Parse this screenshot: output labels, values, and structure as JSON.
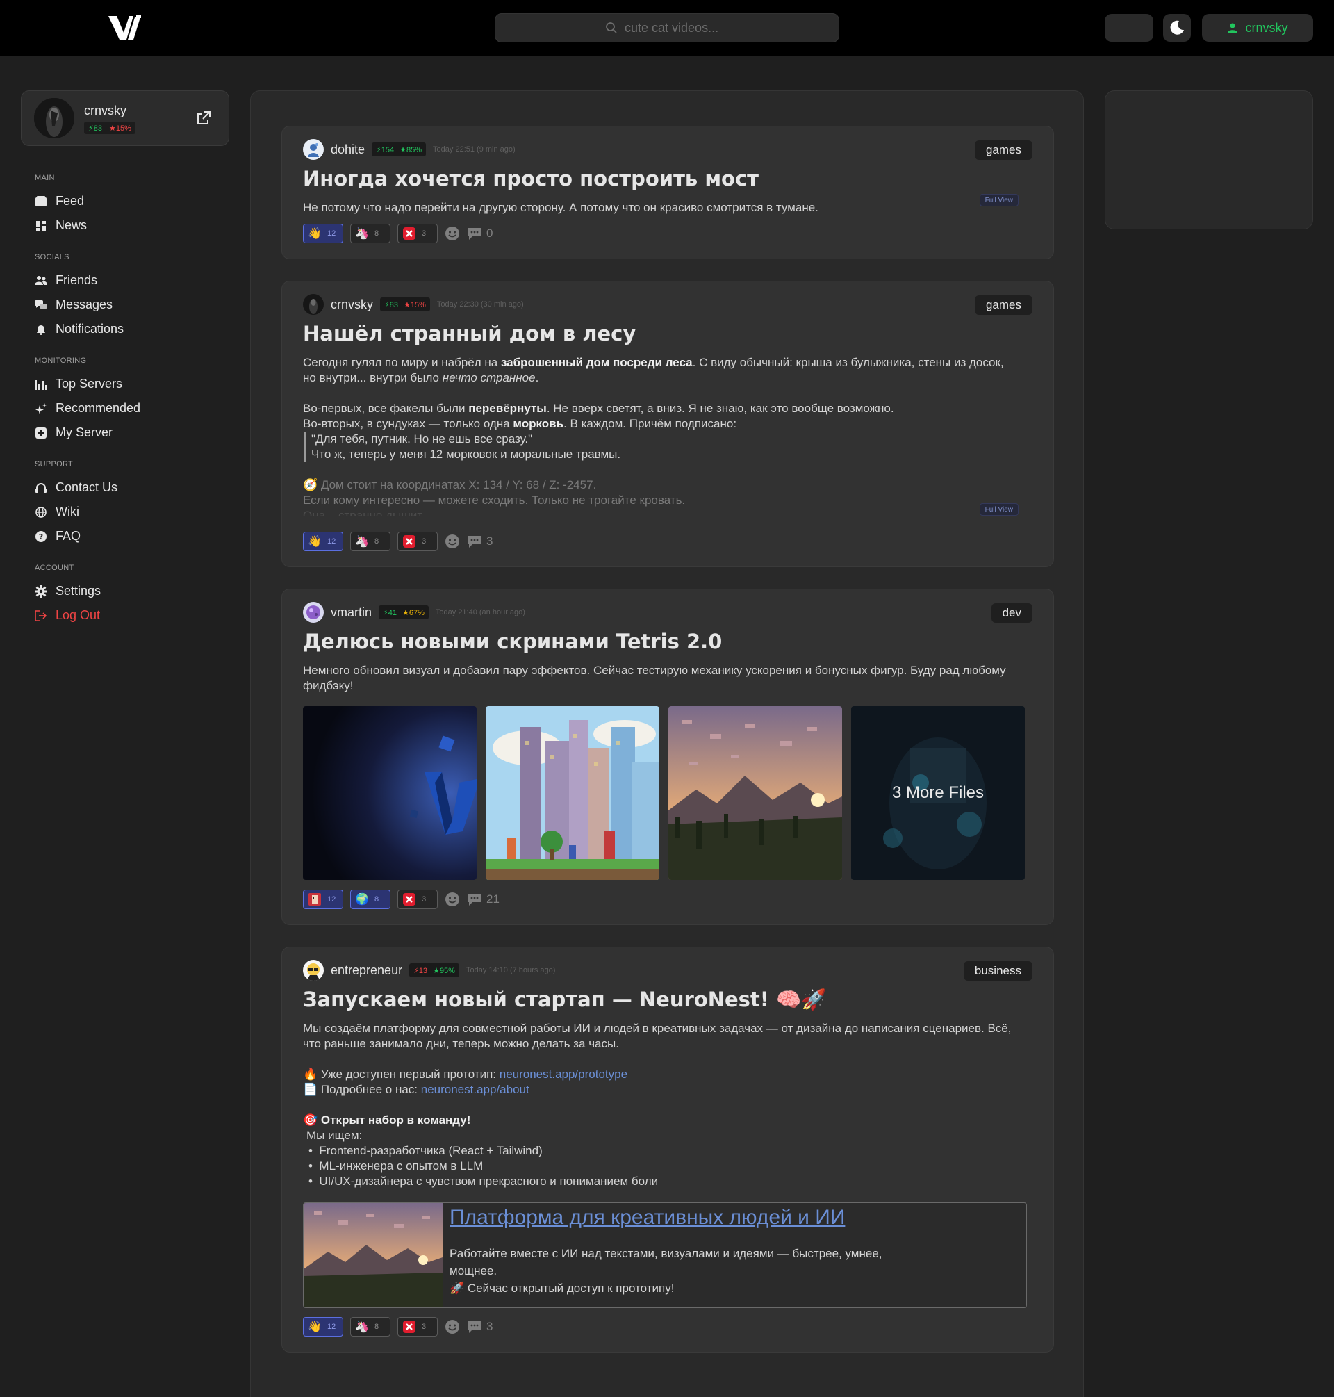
{
  "header": {
    "search_placeholder": "cute cat videos...",
    "username": "crnvsky",
    "accent": "#22c55e"
  },
  "profile": {
    "name": "crnvsky",
    "power": "83",
    "rating": "15%"
  },
  "nav": {
    "sections": [
      {
        "title": "MAIN",
        "items": [
          {
            "label": "Feed",
            "icon": "feed-icon"
          },
          {
            "label": "News",
            "icon": "news-icon"
          }
        ]
      },
      {
        "title": "SOCIALS",
        "items": [
          {
            "label": "Friends",
            "icon": "friends-icon"
          },
          {
            "label": "Messages",
            "icon": "messages-icon"
          },
          {
            "label": "Notifications",
            "icon": "bell-icon"
          }
        ]
      },
      {
        "title": "MONITORING",
        "items": [
          {
            "label": "Top Servers",
            "icon": "chart-icon"
          },
          {
            "label": "Recommended",
            "icon": "sparkle-icon"
          },
          {
            "label": "My Server",
            "icon": "plus-square-icon"
          }
        ]
      },
      {
        "title": "SUPPORT",
        "items": [
          {
            "label": "Contact Us",
            "icon": "headset-icon"
          },
          {
            "label": "Wiki",
            "icon": "globe-icon"
          },
          {
            "label": "FAQ",
            "icon": "question-icon"
          }
        ]
      },
      {
        "title": "ACCOUNT",
        "items": [
          {
            "label": "Settings",
            "icon": "gear-icon"
          },
          {
            "label": "Log Out",
            "icon": "logout-icon"
          }
        ]
      }
    ]
  },
  "posts": [
    {
      "user": "dohite",
      "power": "154",
      "rating": "85%",
      "rating_color": "#22c55e",
      "time": "Today 22:51 (9 min ago)",
      "tag": "games",
      "title": "Иногда хочется просто построить мост",
      "body": "Не потому что надо перейти на другую сторону. А потому что он красиво смотрится в тумане.",
      "full_view": "Full View",
      "reactions": [
        "12",
        "8",
        "3"
      ],
      "comments": "0"
    },
    {
      "user": "crnvsky",
      "power": "83",
      "rating": "15%",
      "rating_color": "#ef4444",
      "time": "Today 22:30 (30 min ago)",
      "tag": "games",
      "title": "Нашёл странный дом в лесу",
      "body": {
        "p1a": "Сегодня гулял по миру и набрёл на ",
        "p1b": "заброшенный дом посреди леса",
        "p1c": ". С виду обычный: крыша из булыжника, стены из досок, но внутри... внутри было ",
        "p1d": "нечто странное",
        "p1e": ".",
        "p2a": "Во-первых, все факелы были ",
        "p2b": "перевёрнуты",
        "p2c": ". Не вверх светят, а вниз. Я не знаю, как это вообще возможно.",
        "p3a": "Во-вторых, в сундуках — только одна ",
        "p3b": "морковь",
        "p3c": ". В каждом. Причём подписано:",
        "q1": "\"Для тебя, путник. Но не ешь все сразу.\"",
        "q2": "Что ж, теперь у меня 12 морковок и моральные травмы.",
        "p4": "🧭 Дом стоит на координатах X: 134 / Y: 68 / Z: -2457.",
        "p5": "Если кому интересно — можете сходить. Только не трогайте кровать.",
        "p6": "Она... странно дышит."
      },
      "full_view": "Full View",
      "reactions": [
        "12",
        "8",
        "3"
      ],
      "comments": "3"
    },
    {
      "user": "vmartin",
      "power": "41",
      "rating": "67%",
      "rating_color": "#eab308",
      "time": "Today 21:40 (an hour ago)",
      "tag": "dev",
      "title": "Делюсь новыми скринами Tetris 2.0",
      "body": "Немного обновил визуал и добавил пару эффектов. Сейчас тестирую механику ускорения и бонусных фигур. Буду рад любому фидбэку!",
      "more_files": "3 More Files",
      "reactions": [
        "12",
        "8",
        "3"
      ],
      "comments": "21"
    },
    {
      "user": "entrepreneur",
      "power": "13",
      "rating": "95%",
      "rating_color": "#22c55e",
      "time": "Today 14:10 (7 hours ago)",
      "tag": "business",
      "title": "Запускаем новый стартап — NeuroNest! 🧠🚀",
      "body": {
        "p1": "Мы создаём платформу для совместной работы ИИ и людей в креативных задачах — от дизайна до написания сценариев. Всё, что раньше занимало дни, теперь можно делать за часы.",
        "l1a": "🔥 Уже доступен первый прототип: ",
        "l1b": "neuronest.app/prototype",
        "l2a": "📄 Подробнее о нас: ",
        "l2b": "neuronest.app/about",
        "h": "🎯 Открыт набор в команду!",
        "we": "Мы ищем:",
        "b1": "Frontend-разработчика (React + Tailwind)",
        "b2": "ML-инженера с опытом в LLM",
        "b3": "UI/UX-дизайнера с чувством прекрасного и пониманием боли"
      },
      "link_card": {
        "title": "Платформа для креативных людей и ИИ",
        "desc1": "Работайте вместе с ИИ над текстами, визуалами и идеями — быстрее, умнее, мощнее.",
        "desc2": "🚀 Сейчас открытый доступ к прототипу!"
      },
      "reactions": [
        "12",
        "8",
        "3"
      ],
      "comments": "3"
    }
  ]
}
